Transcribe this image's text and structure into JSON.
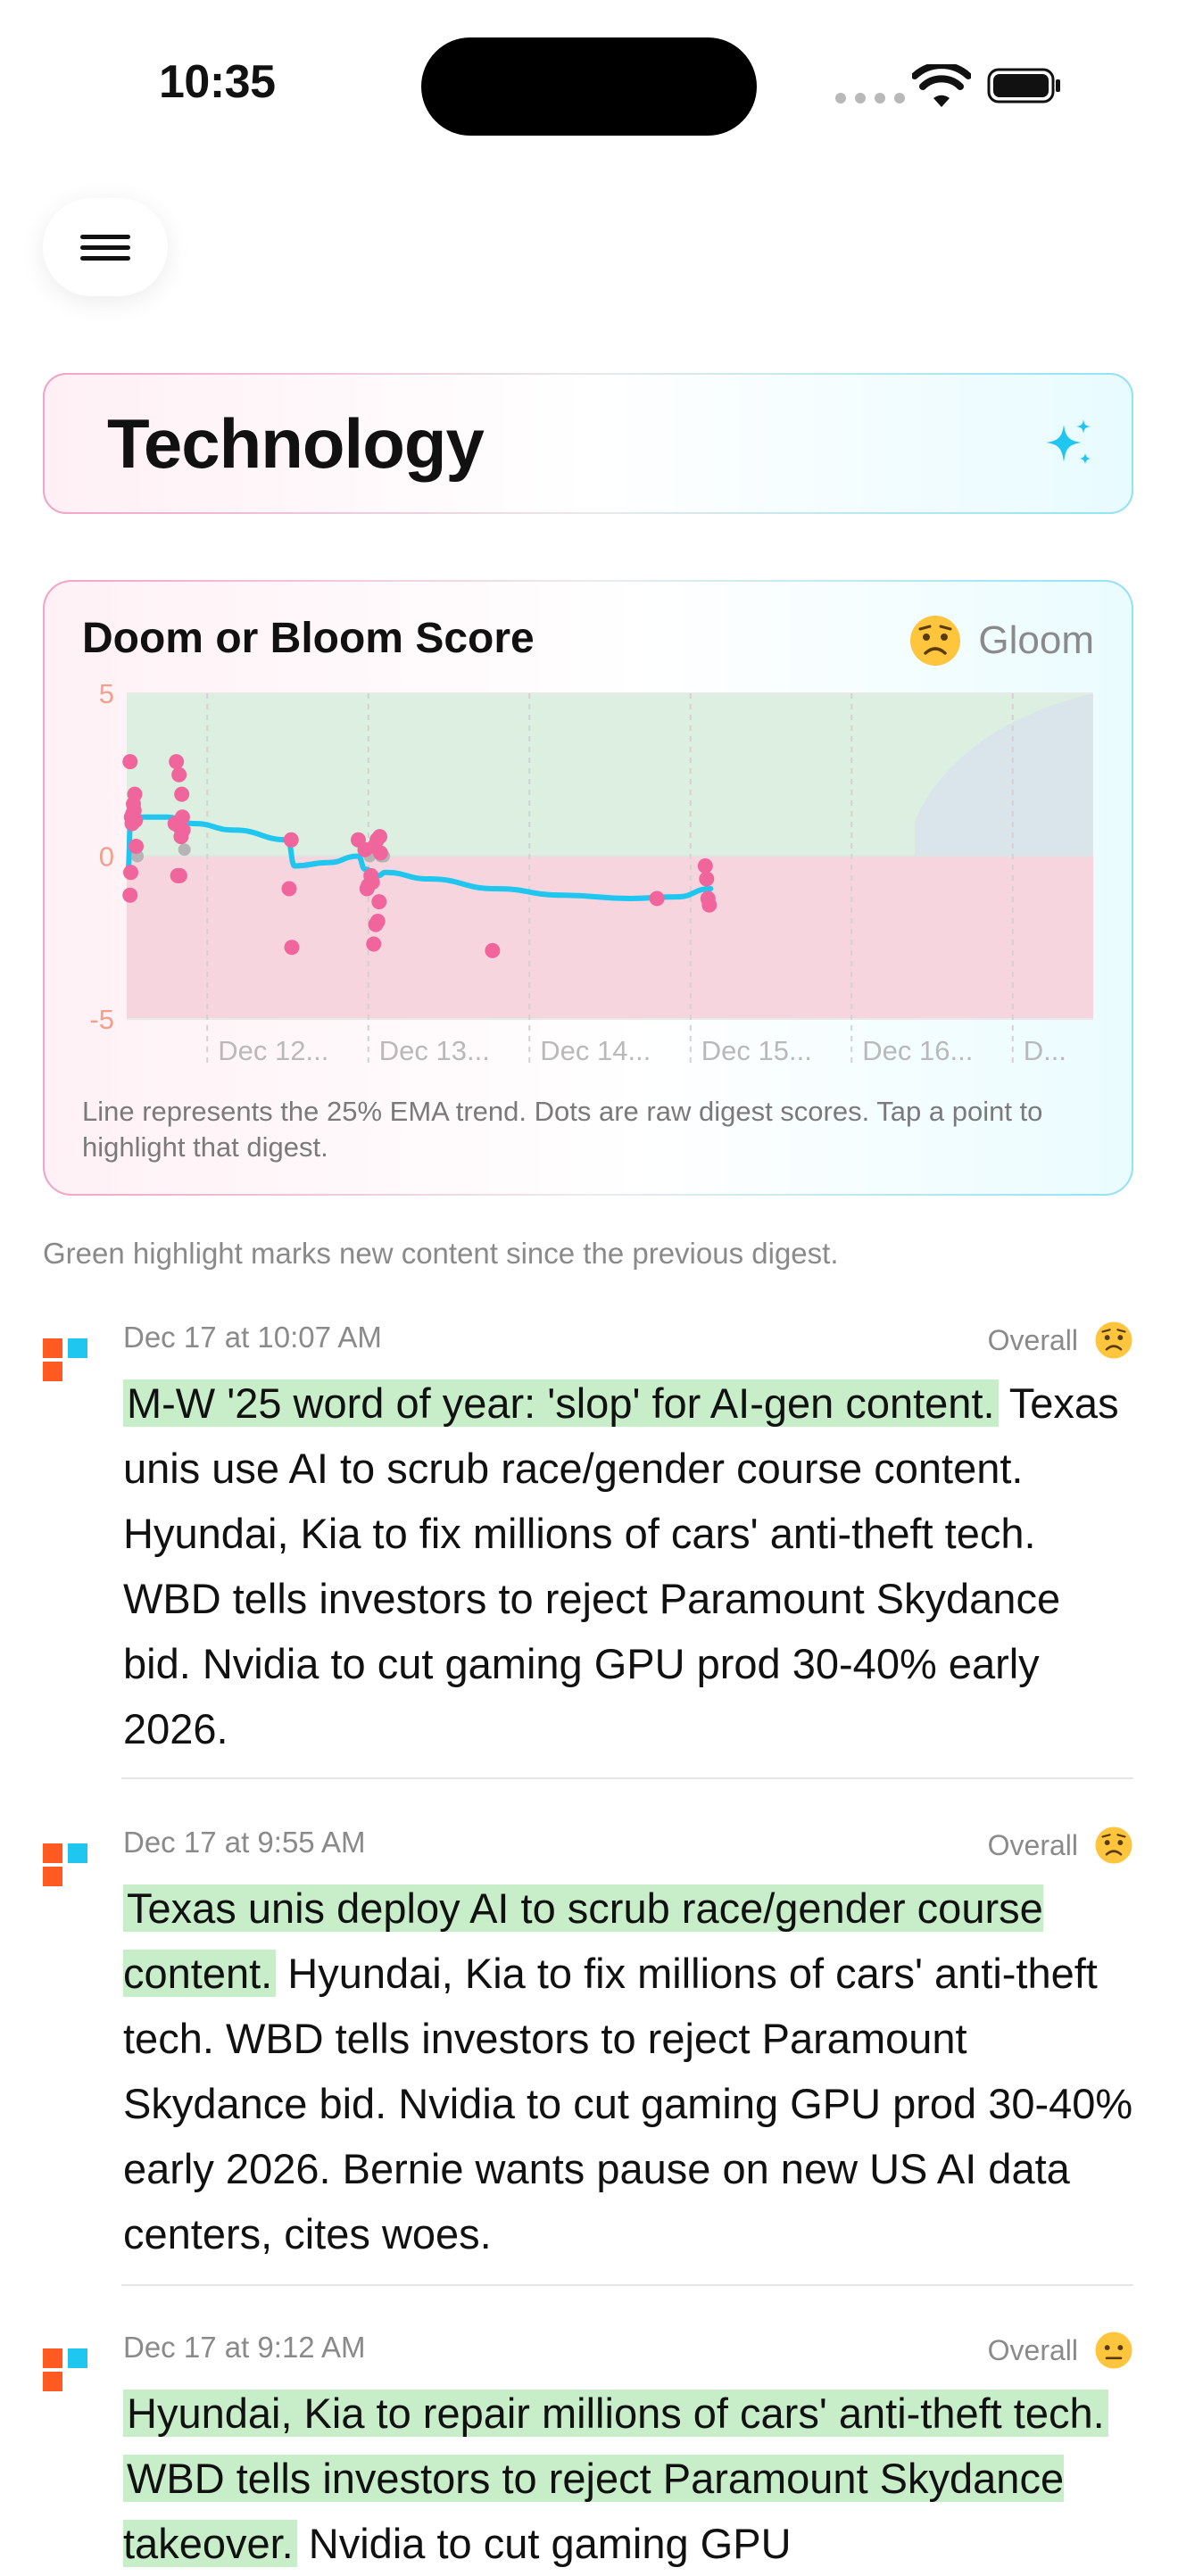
{
  "status_bar": {
    "time": "10:35"
  },
  "page": {
    "title": "Technology"
  },
  "chart_card": {
    "title": "Doom or Bloom Score",
    "mood_label": "Gloom",
    "mood_icon": "worried-face-icon",
    "note": "Line represents the 25% EMA trend. Dots are raw digest scores. Tap a point to highlight that digest."
  },
  "chart_data": {
    "type": "scatter",
    "title": "Doom or Bloom Score",
    "xlabel": "",
    "ylabel": "",
    "ylim": [
      -5,
      5
    ],
    "y_ticks": [
      "5",
      "0",
      "-5"
    ],
    "x_ticks": [
      "Dec 12...",
      "Dec 13...",
      "Dec 14...",
      "Dec 15...",
      "Dec 16...",
      "D..."
    ],
    "xlim": [
      "Dec 11 12:00",
      "Dec 17 11:00"
    ],
    "x_hours": [
      0,
      144
    ],
    "grid": true,
    "zones": [
      {
        "name": "bloom",
        "range": [
          0,
          5
        ],
        "color": "#dcefe1"
      },
      {
        "name": "doom",
        "range": [
          -5,
          0
        ],
        "color": "#f7d5de"
      }
    ],
    "points_hours_scores": [
      [
        0.5,
        2.9
      ],
      [
        0.7,
        1.2
      ],
      [
        0.8,
        1.0
      ],
      [
        1.0,
        1.6
      ],
      [
        1.1,
        1.4
      ],
      [
        1.2,
        1.9
      ],
      [
        1.4,
        0.3
      ],
      [
        0.6,
        -0.5
      ],
      [
        0.5,
        -1.2
      ],
      [
        0.9,
        1.3
      ],
      [
        1.3,
        1.1
      ],
      [
        7.4,
        2.9
      ],
      [
        7.8,
        2.5
      ],
      [
        8.2,
        1.9
      ],
      [
        8.3,
        1.2
      ],
      [
        7.9,
        0.9
      ],
      [
        8.1,
        0.6
      ],
      [
        8.4,
        0.8
      ],
      [
        7.2,
        1.0
      ],
      [
        7.6,
        -0.6
      ],
      [
        7.9,
        -0.6
      ],
      [
        24.5,
        0.5
      ],
      [
        24.2,
        -1.0
      ],
      [
        24.6,
        -2.8
      ],
      [
        34.5,
        0.5
      ],
      [
        35.5,
        0.2
      ],
      [
        36.0,
        -0.9
      ],
      [
        36.4,
        -0.6
      ],
      [
        36.9,
        0.3
      ],
      [
        37.3,
        0.5
      ],
      [
        37.8,
        0.1
      ],
      [
        37.6,
        -1.4
      ],
      [
        37.1,
        -2.1
      ],
      [
        37.4,
        -2.0
      ],
      [
        36.8,
        -2.7
      ],
      [
        35.8,
        -1.0
      ],
      [
        36.6,
        -0.8
      ],
      [
        37.7,
        0.6
      ],
      [
        54.5,
        -2.9
      ],
      [
        79.0,
        -1.3
      ],
      [
        86.2,
        -0.3
      ],
      [
        86.4,
        -0.7
      ],
      [
        86.6,
        -1.3
      ],
      [
        86.8,
        -1.5
      ]
    ],
    "ema_trend": [
      [
        0.2,
        -0.4
      ],
      [
        0.6,
        1.2
      ],
      [
        2.0,
        1.2
      ],
      [
        6.0,
        1.2
      ],
      [
        10.0,
        1.0
      ],
      [
        16.0,
        0.8
      ],
      [
        24.0,
        0.5
      ],
      [
        25.0,
        -0.3
      ],
      [
        30.0,
        -0.2
      ],
      [
        34.5,
        0.0
      ],
      [
        35.5,
        -0.4
      ],
      [
        37.5,
        -0.6
      ],
      [
        38.5,
        -0.5
      ],
      [
        45.0,
        -0.7
      ],
      [
        55.0,
        -1.0
      ],
      [
        65.0,
        -1.2
      ],
      [
        75.0,
        -1.3
      ],
      [
        82.0,
        -1.25
      ],
      [
        87.0,
        -1.0
      ]
    ],
    "series": [
      {
        "values_ref": "points_hours_scores",
        "color": "#f0669c"
      },
      {
        "values_ref": "ema_trend",
        "color": "#1fc6ef"
      }
    ],
    "x_tick_hours": [
      12,
      36,
      60,
      84,
      108,
      132
    ]
  },
  "feed": {
    "note": "Green highlight marks new content since the previous digest.",
    "overall_label": "Overall",
    "entries": [
      {
        "date": "Dec 17 at 10:07 AM",
        "mood_icon": "worried-face-icon",
        "highlight": "M-W '25 word of year: 'slop' for AI-gen content.",
        "text": " Texas unis use AI to scrub race/gender course content. Hyundai, Kia to fix millions of cars' anti-theft tech. WBD tells investors to reject Paramount Skydance bid. Nvidia to cut gaming GPU prod 30-40% early 2026."
      },
      {
        "date": "Dec 17 at 9:55 AM",
        "mood_icon": "worried-face-icon",
        "highlight": "Texas unis deploy AI to scrub race/gender course content.",
        "text": " Hyundai, Kia to fix millions of cars' anti-theft tech. WBD tells investors to reject Paramount Skydance bid. Nvidia to cut gaming GPU prod 30-40% early 2026. Bernie wants pause on new US AI data centers, cites woes."
      },
      {
        "date": "Dec 17 at 9:12 AM",
        "mood_icon": "neutral-face-icon",
        "highlight": "Hyundai, Kia to repair millions of cars' anti-theft tech.",
        "highlight2": "WBD tells investors to reject Paramount Skydance takeover.",
        "text": " Nvidia to cut gaming GPU"
      }
    ]
  },
  "colors": {
    "accent_pink": "#f0669c",
    "accent_cyan": "#1fc6ef",
    "highlight_green": "#c7edc9",
    "logo_orange": "#ff5a1f",
    "logo_blue": "#1fc6ef"
  }
}
